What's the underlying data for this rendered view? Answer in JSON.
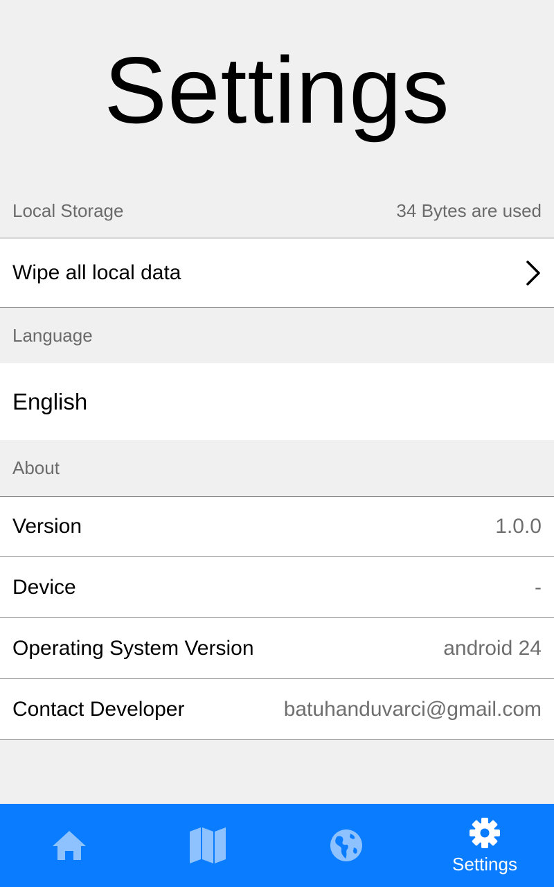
{
  "header": {
    "title": "Settings"
  },
  "sections": {
    "local_storage": {
      "header": "Local Storage",
      "usage": "34 Bytes are used",
      "wipe_label": "Wipe all local data"
    },
    "language": {
      "header": "Language",
      "current": "English"
    },
    "about": {
      "header": "About",
      "rows": [
        {
          "label": "Version",
          "value": "1.0.0"
        },
        {
          "label": "Device",
          "value": "-"
        },
        {
          "label": "Operating System Version",
          "value": "android 24"
        },
        {
          "label": "Contact Developer",
          "value": "batuhanduvarci@gmail.com"
        }
      ]
    }
  },
  "tabbar": {
    "items": [
      {
        "icon": "home-icon",
        "label": ""
      },
      {
        "icon": "map-icon",
        "label": ""
      },
      {
        "icon": "globe-icon",
        "label": ""
      },
      {
        "icon": "gear-icon",
        "label": "Settings",
        "active": true
      }
    ]
  },
  "colors": {
    "tabbar_bg": "#0a7cff",
    "tab_inactive": "#8ec2ff",
    "tab_active": "#ffffff",
    "page_bg": "#f0f0f0",
    "secondary_text": "#6e6e6e"
  }
}
